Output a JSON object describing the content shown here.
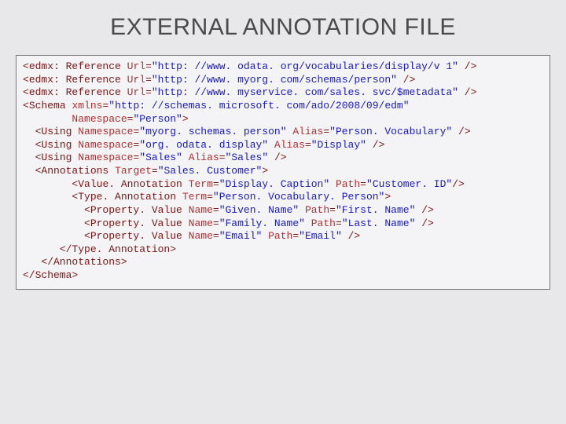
{
  "title": "EXTERNAL ANNOTATION FILE",
  "code": {
    "ref1_url": "\"http: //www. odata. org/vocabularies/display/v 1\"",
    "ref2_url": "\"http: //www. myorg. com/schemas/person\"",
    "ref3_url": "\"http: //www. myservice. com/sales. svc/$metadata\"",
    "schema_xmlns": "\"http: //schemas. microsoft. com/ado/2008/09/edm\"",
    "schema_ns": "\"Person\"",
    "using1_ns": "\"myorg. schemas. person\"",
    "using1_alias": "\"Person. Vocabulary\"",
    "using2_ns": "\"org. odata. display\"",
    "using2_alias": "\"Display\"",
    "using3_ns": "\"Sales\"",
    "using3_alias": "\"Sales\"",
    "ann_target": "\"Sales. Customer\"",
    "va_term": "\"Display. Caption\"",
    "va_path": "\"Customer. ID\"",
    "ta_term": "\"Person. Vocabulary. Person\"",
    "pv1_name": "\"Given. Name\"",
    "pv1_path": "\"First. Name\"",
    "pv2_name": "\"Family. Name\"",
    "pv2_path": "\"Last. Name\"",
    "pv3_name": "\"Email\"",
    "pv3_path": "\"Email\"",
    "lt": "<",
    "gt": ">",
    "sl": "/",
    "el_ref": "edmx: Reference",
    "el_schema": "Schema",
    "el_using": "Using",
    "el_ann": "Annotations",
    "el_va": "Value. Annotation",
    "el_ta": "Type. Annotation",
    "el_pv": "Property. Value",
    "a_url": "Url",
    "a_xmlns": "xmlns",
    "a_ns": "Namespace",
    "a_alias": "Alias",
    "a_target": "Target",
    "a_term": "Term",
    "a_path": "Path",
    "a_name": "Name",
    "cl_ta": "</Type. Annotation>",
    "cl_ann": "</Annotations>",
    "cl_schema": "</Schema>"
  }
}
